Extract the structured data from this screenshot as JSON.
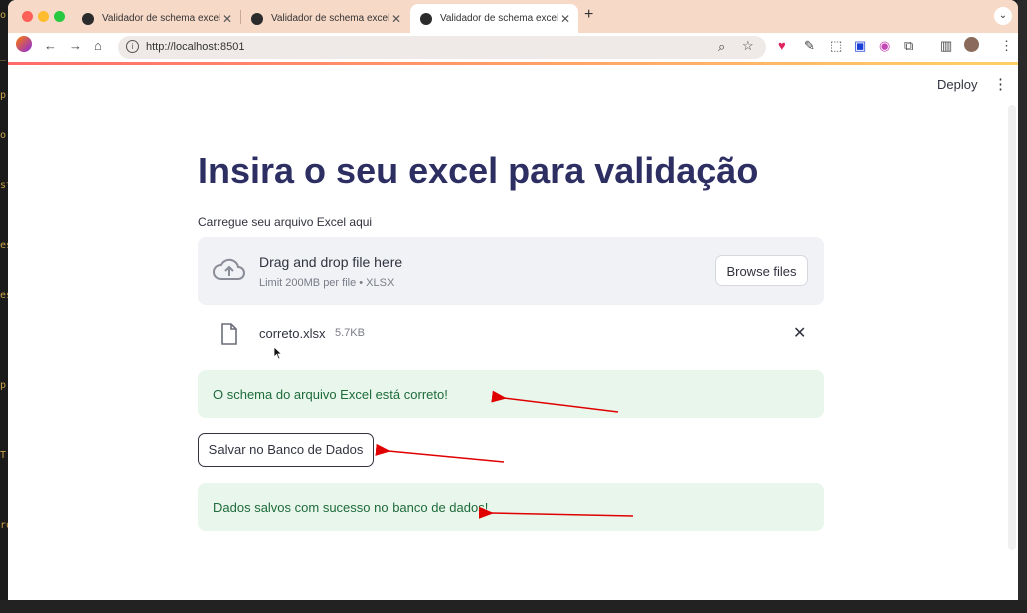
{
  "browser": {
    "tabs": [
      {
        "title": "Validador de schema excel"
      },
      {
        "title": "Validador de schema excel"
      },
      {
        "title": "Validador de schema excel"
      }
    ],
    "url": "http://localhost:8501"
  },
  "app": {
    "deploy_label": "Deploy",
    "heading": "Insira o seu excel para validação",
    "uploader": {
      "label": "Carregue seu arquivo Excel aqui",
      "drop_title": "Drag and drop file here",
      "drop_subtitle": "Limit 200MB per file • XLSX",
      "browse_label": "Browse files"
    },
    "file": {
      "name": "correto.xlsx",
      "size": "5.7KB"
    },
    "success_schema": "O schema do arquivo Excel está correto!",
    "save_button": "Salvar no Banco de Dados",
    "success_saved": "Dados salvos com sucesso no banco de dados!"
  },
  "colors": {
    "heading": "#2d2f63",
    "success_bg": "#e9f6ec",
    "success_text": "#1e6b3a",
    "annotation_arrow": "#e00000"
  }
}
